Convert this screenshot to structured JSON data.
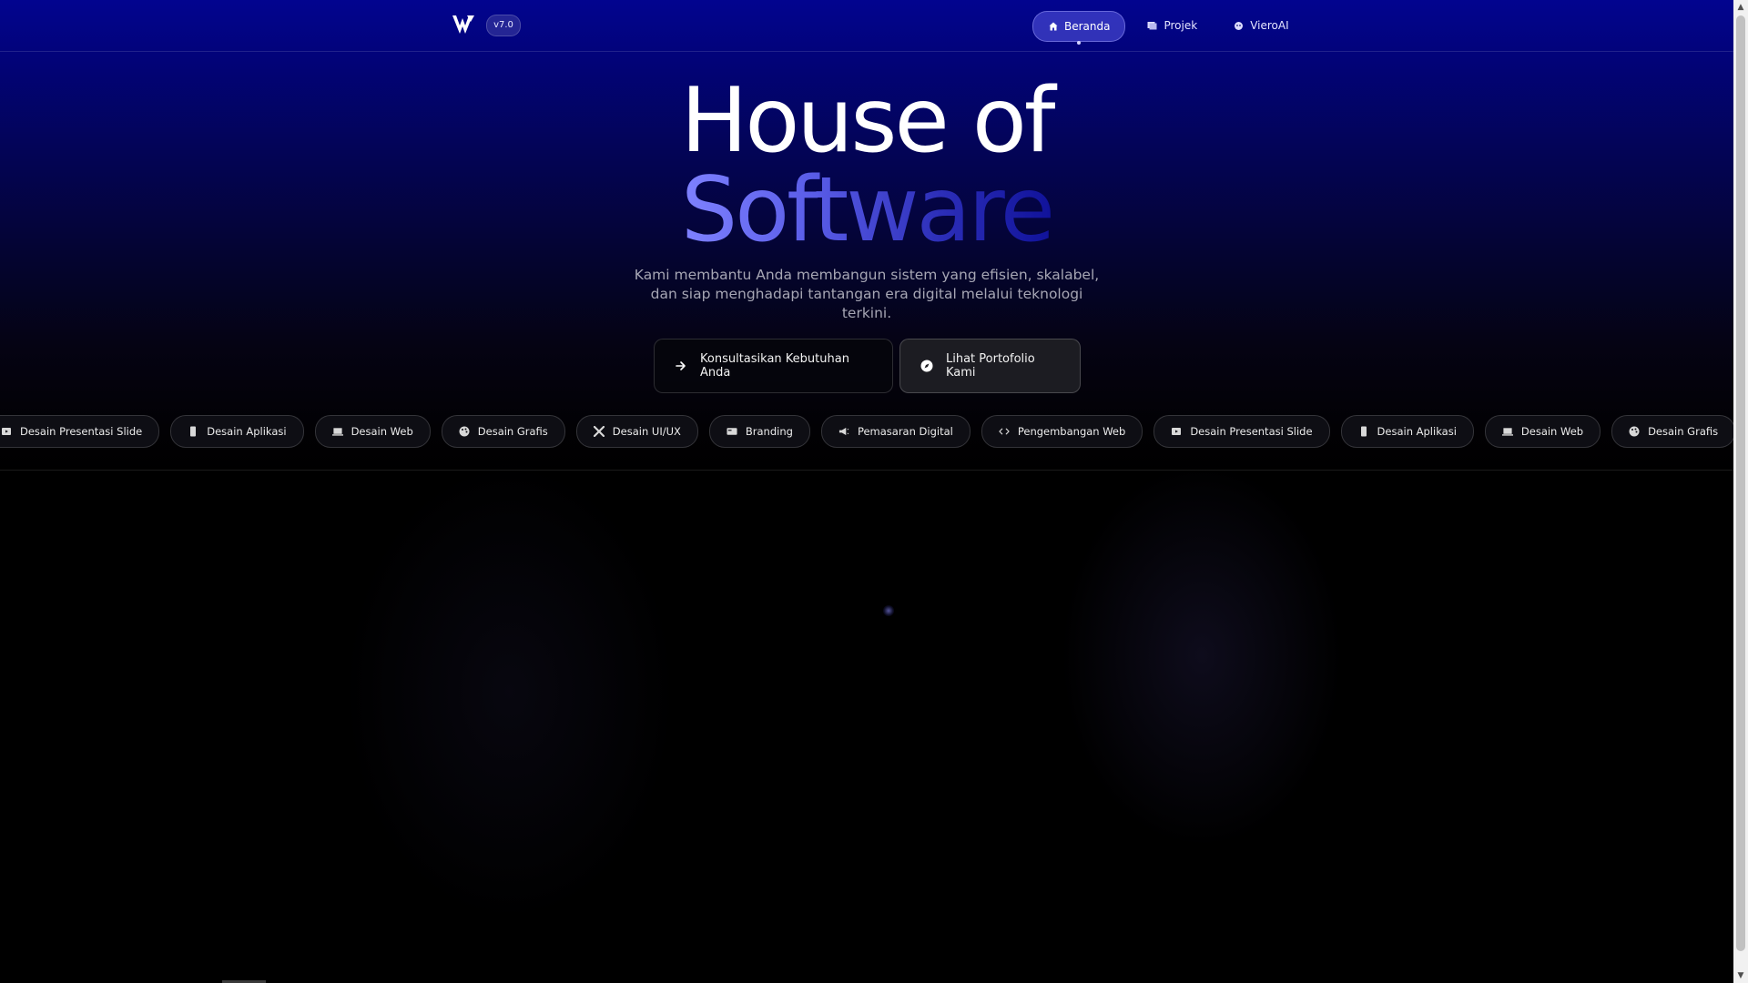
{
  "header": {
    "version": "v7.0",
    "nav": [
      {
        "label": "Beranda",
        "icon": "home-icon",
        "active": true
      },
      {
        "label": "Projek",
        "icon": "folder-icon",
        "active": false
      },
      {
        "label": "VieroAI",
        "icon": "bot-icon",
        "active": false
      }
    ]
  },
  "hero": {
    "title_line1": "House of",
    "title_line2": "Software",
    "subtitle": "Kami membantu Anda membangun sistem yang efisien, skalabel, dan siap menghadapi tantangan era digital melalui teknologi terkini.",
    "cta_primary": "Konsultasikan Kebutuhan Anda",
    "cta_secondary": "Lihat Portofolio Kami"
  },
  "services": [
    {
      "label": "Desain Presentasi Slide",
      "icon": "slides-icon"
    },
    {
      "label": "Desain Aplikasi",
      "icon": "phone-icon"
    },
    {
      "label": "Desain Web",
      "icon": "laptop-icon"
    },
    {
      "label": "Desain Grafis",
      "icon": "palette-icon"
    },
    {
      "label": "Desain UI/UX",
      "icon": "tools-icon"
    },
    {
      "label": "Branding",
      "icon": "id-card-icon"
    },
    {
      "label": "Pemasaran Digital",
      "icon": "megaphone-icon"
    },
    {
      "label": "Pengembangan Web",
      "icon": "code-icon"
    },
    {
      "label": "Desain Presentasi Slide",
      "icon": "slides-icon"
    },
    {
      "label": "Desain Aplikasi",
      "icon": "phone-icon"
    },
    {
      "label": "Desain Web",
      "icon": "laptop-icon"
    },
    {
      "label": "Desain Grafis",
      "icon": "palette-icon"
    },
    {
      "label": "Desain UI/UX",
      "icon": "tools-icon"
    }
  ],
  "colors": {
    "header_bg": "#02048f",
    "accent": "#7f82ff",
    "nav_active_bg": "#5a5ae6"
  }
}
